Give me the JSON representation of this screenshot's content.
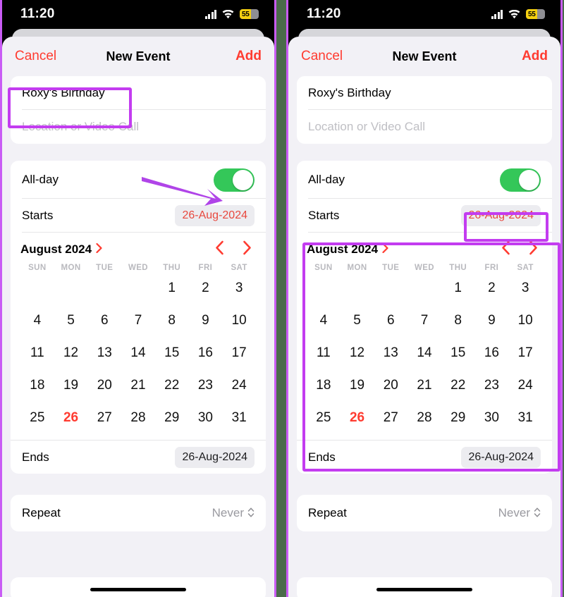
{
  "status_bar": {
    "time": "11:20",
    "battery_percent": "55",
    "icons": [
      "cellular-signal-icon",
      "wifi-icon",
      "battery-icon"
    ]
  },
  "nav": {
    "cancel_label": "Cancel",
    "title": "New Event",
    "add_label": "Add"
  },
  "form": {
    "title_value": "Roxy's Birthday",
    "location_placeholder": "Location or Video Call",
    "all_day_label": "All-day",
    "all_day_state": "on",
    "starts_label": "Starts",
    "starts_value": "26-Aug-2024",
    "ends_label": "Ends",
    "ends_value": "26-Aug-2024",
    "repeat_label": "Repeat",
    "repeat_value": "Never"
  },
  "calendar": {
    "month_label": "August 2024",
    "prev_label": "‹",
    "next_label": "›",
    "month_chevron": "›",
    "weekdays": [
      "SUN",
      "MON",
      "TUE",
      "WED",
      "THU",
      "FRI",
      "SAT"
    ],
    "lead_blanks": 4,
    "days": [
      1,
      2,
      3,
      4,
      5,
      6,
      7,
      8,
      9,
      10,
      11,
      12,
      13,
      14,
      15,
      16,
      17,
      18,
      19,
      20,
      21,
      22,
      23,
      24,
      25,
      26,
      27,
      28,
      29,
      30,
      31
    ],
    "selected_day": 26
  },
  "colors": {
    "accent_red": "#ff3b30",
    "toggle_green": "#34c759",
    "highlight_purple": "#c33cf0",
    "divider_green": "#4a6b4a",
    "sheet_bg": "#f2f1f6",
    "battery_yellow": "#f5d010"
  },
  "annotations": {
    "left_panel": [
      "title-field-highlight",
      "toggle-arrow"
    ],
    "right_panel": [
      "starts-chip-highlight",
      "calendar-highlight"
    ]
  }
}
